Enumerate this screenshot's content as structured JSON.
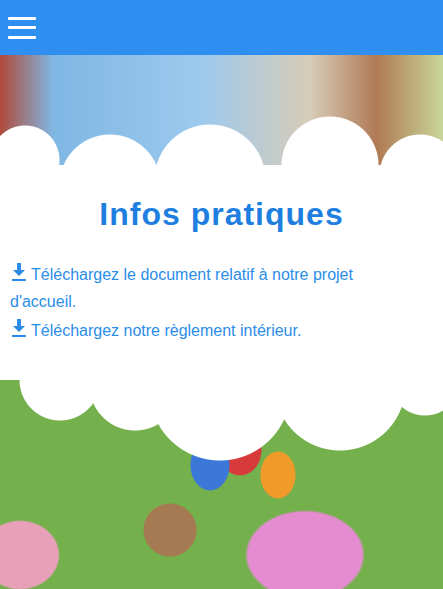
{
  "section": {
    "title": "Infos pratiques",
    "links": [
      {
        "text": "Téléchargez le document relatif à notre projet d'accueil."
      },
      {
        "text": "Téléchargez notre règlement intérieur."
      }
    ]
  }
}
